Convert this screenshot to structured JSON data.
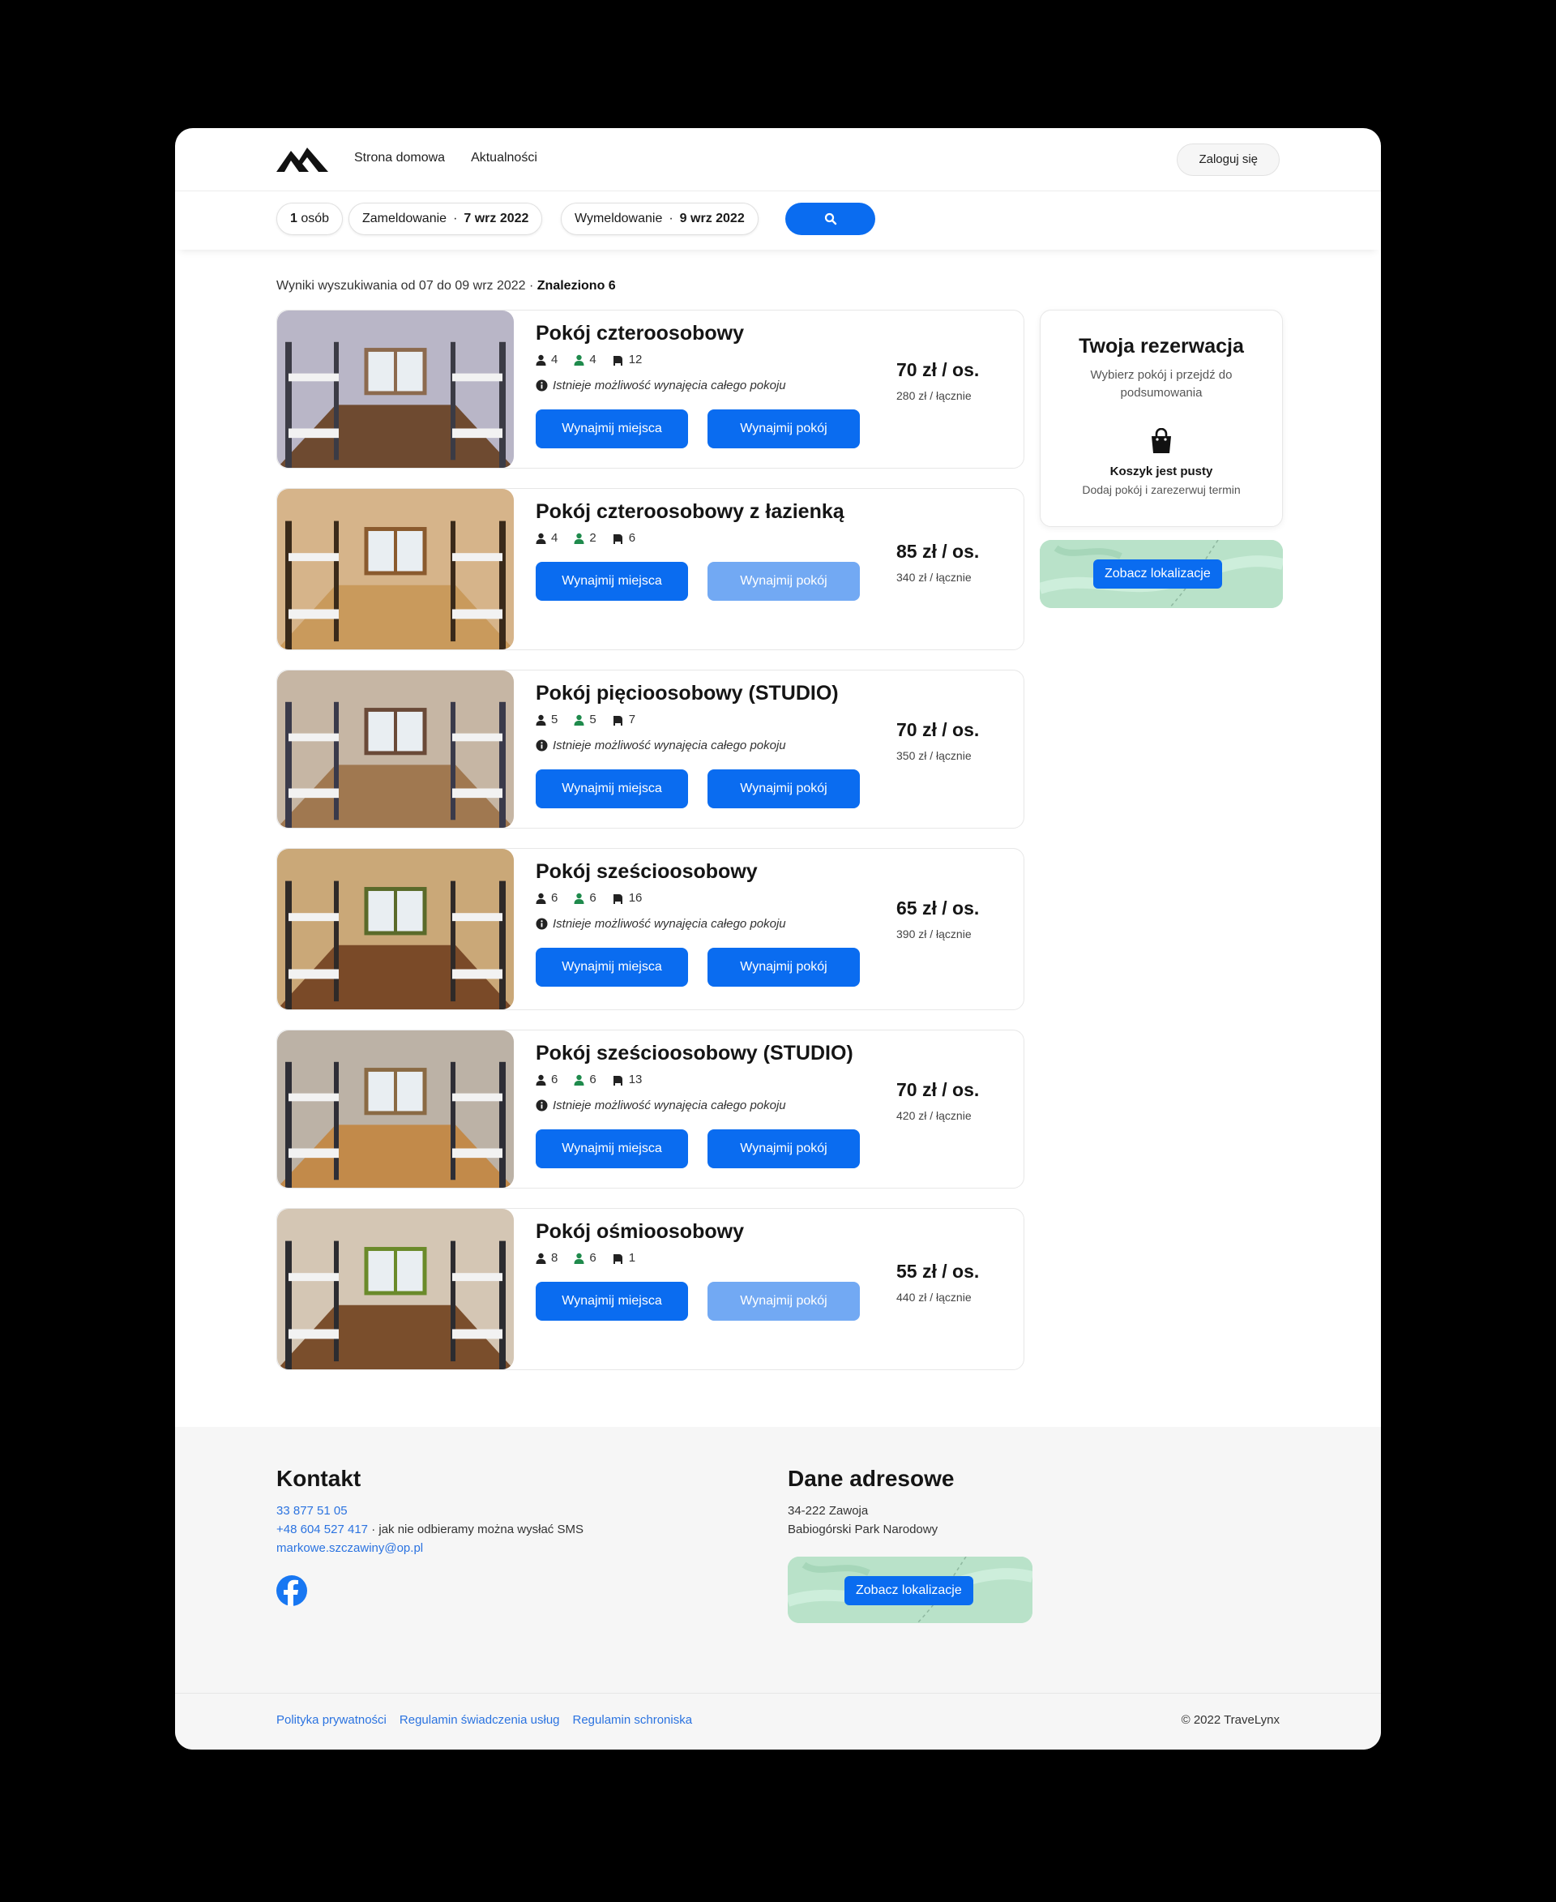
{
  "header": {
    "nav": [
      "Strona domowa",
      "Aktualności"
    ],
    "login_label": "Zaloguj się"
  },
  "search": {
    "guests_count": "1",
    "guests_unit": "osób",
    "checkin_label": "Zameldowanie",
    "checkin_date": "7 wrz 2022",
    "checkout_label": "Wymeldowanie",
    "checkout_date": "9 wrz 2022",
    "separator": "·"
  },
  "results": {
    "range_text": "Wyniki wyszukiwania od 07 do 09 wrz 2022 · ",
    "found_text": "Znaleziono 6"
  },
  "rent_places_label": "Wynajmij miejsca",
  "rent_room_label": "Wynajmij pokój",
  "whole_room_note": "Istnieje możliwość wynajęcia całego pokoju",
  "rooms": [
    {
      "name": "Pokój czteroosobowy",
      "capacity": "4",
      "available": "4",
      "beds": "12",
      "price": "70 zł / os.",
      "total": "280 zł / łącznie",
      "whole_room_available": true,
      "rent_room_disabled": false
    },
    {
      "name": "Pokój czteroosobowy z łazienką",
      "capacity": "4",
      "available": "2",
      "beds": "6",
      "price": "85 zł / os.",
      "total": "340 zł / łącznie",
      "whole_room_available": false,
      "rent_room_disabled": true
    },
    {
      "name": "Pokój pięcioosobowy (STUDIO)",
      "capacity": "5",
      "available": "5",
      "beds": "7",
      "price": "70 zł / os.",
      "total": "350 zł / łącznie",
      "whole_room_available": true,
      "rent_room_disabled": false
    },
    {
      "name": "Pokój sześcioosobowy",
      "capacity": "6",
      "available": "6",
      "beds": "16",
      "price": "65 zł / os.",
      "total": "390 zł / łącznie",
      "whole_room_available": true,
      "rent_room_disabled": false
    },
    {
      "name": "Pokój sześcioosobowy (STUDIO)",
      "capacity": "6",
      "available": "6",
      "beds": "13",
      "price": "70 zł / os.",
      "total": "420 zł / łącznie",
      "whole_room_available": true,
      "rent_room_disabled": false
    },
    {
      "name": "Pokój ośmioosobowy",
      "capacity": "8",
      "available": "6",
      "beds": "1",
      "price": "55 zł / os.",
      "total": "440 zł / łącznie",
      "whole_room_available": false,
      "rent_room_disabled": true
    }
  ],
  "reservation": {
    "title": "Twoja rezerwacja",
    "subtitle": "Wybierz pokój i przejdź do podsumowania",
    "cart_empty": "Koszyk jest pusty",
    "cart_hint": "Dodaj pokój i zarezerwuj termin"
  },
  "map_button_label": "Zobacz lokalizacje",
  "footer": {
    "contact_title": "Kontakt",
    "phone1": "33 877 51 05",
    "phone2": "+48 604 527 417",
    "phone2_note": " · jak nie odbieramy można wysłać SMS",
    "email": "markowe.szczawiny@op.pl",
    "address_title": "Dane adresowe",
    "address_line1": "34-222 Zawoja",
    "address_line2": "Babiogórski Park Narodowy",
    "links": [
      "Polityka prywatności",
      "Regulamin świadczenia usług",
      "Regulamin schroniska"
    ],
    "copyright": "© 2022 TraveLynx"
  },
  "icons": {
    "logo": "mountains-logo",
    "search": "search-icon",
    "capacity": "person-icon",
    "available": "person-available-icon",
    "beds": "bed-icon",
    "info": "info-icon",
    "cart": "shopping-bag-icon",
    "social": "facebook-icon"
  },
  "colors": {
    "primary": "#0a6cf0",
    "primary_disabled": "#72a9f3",
    "available_green": "#1f8a4c",
    "link": "#2b73e0",
    "map_green": "#b9e2c9"
  }
}
